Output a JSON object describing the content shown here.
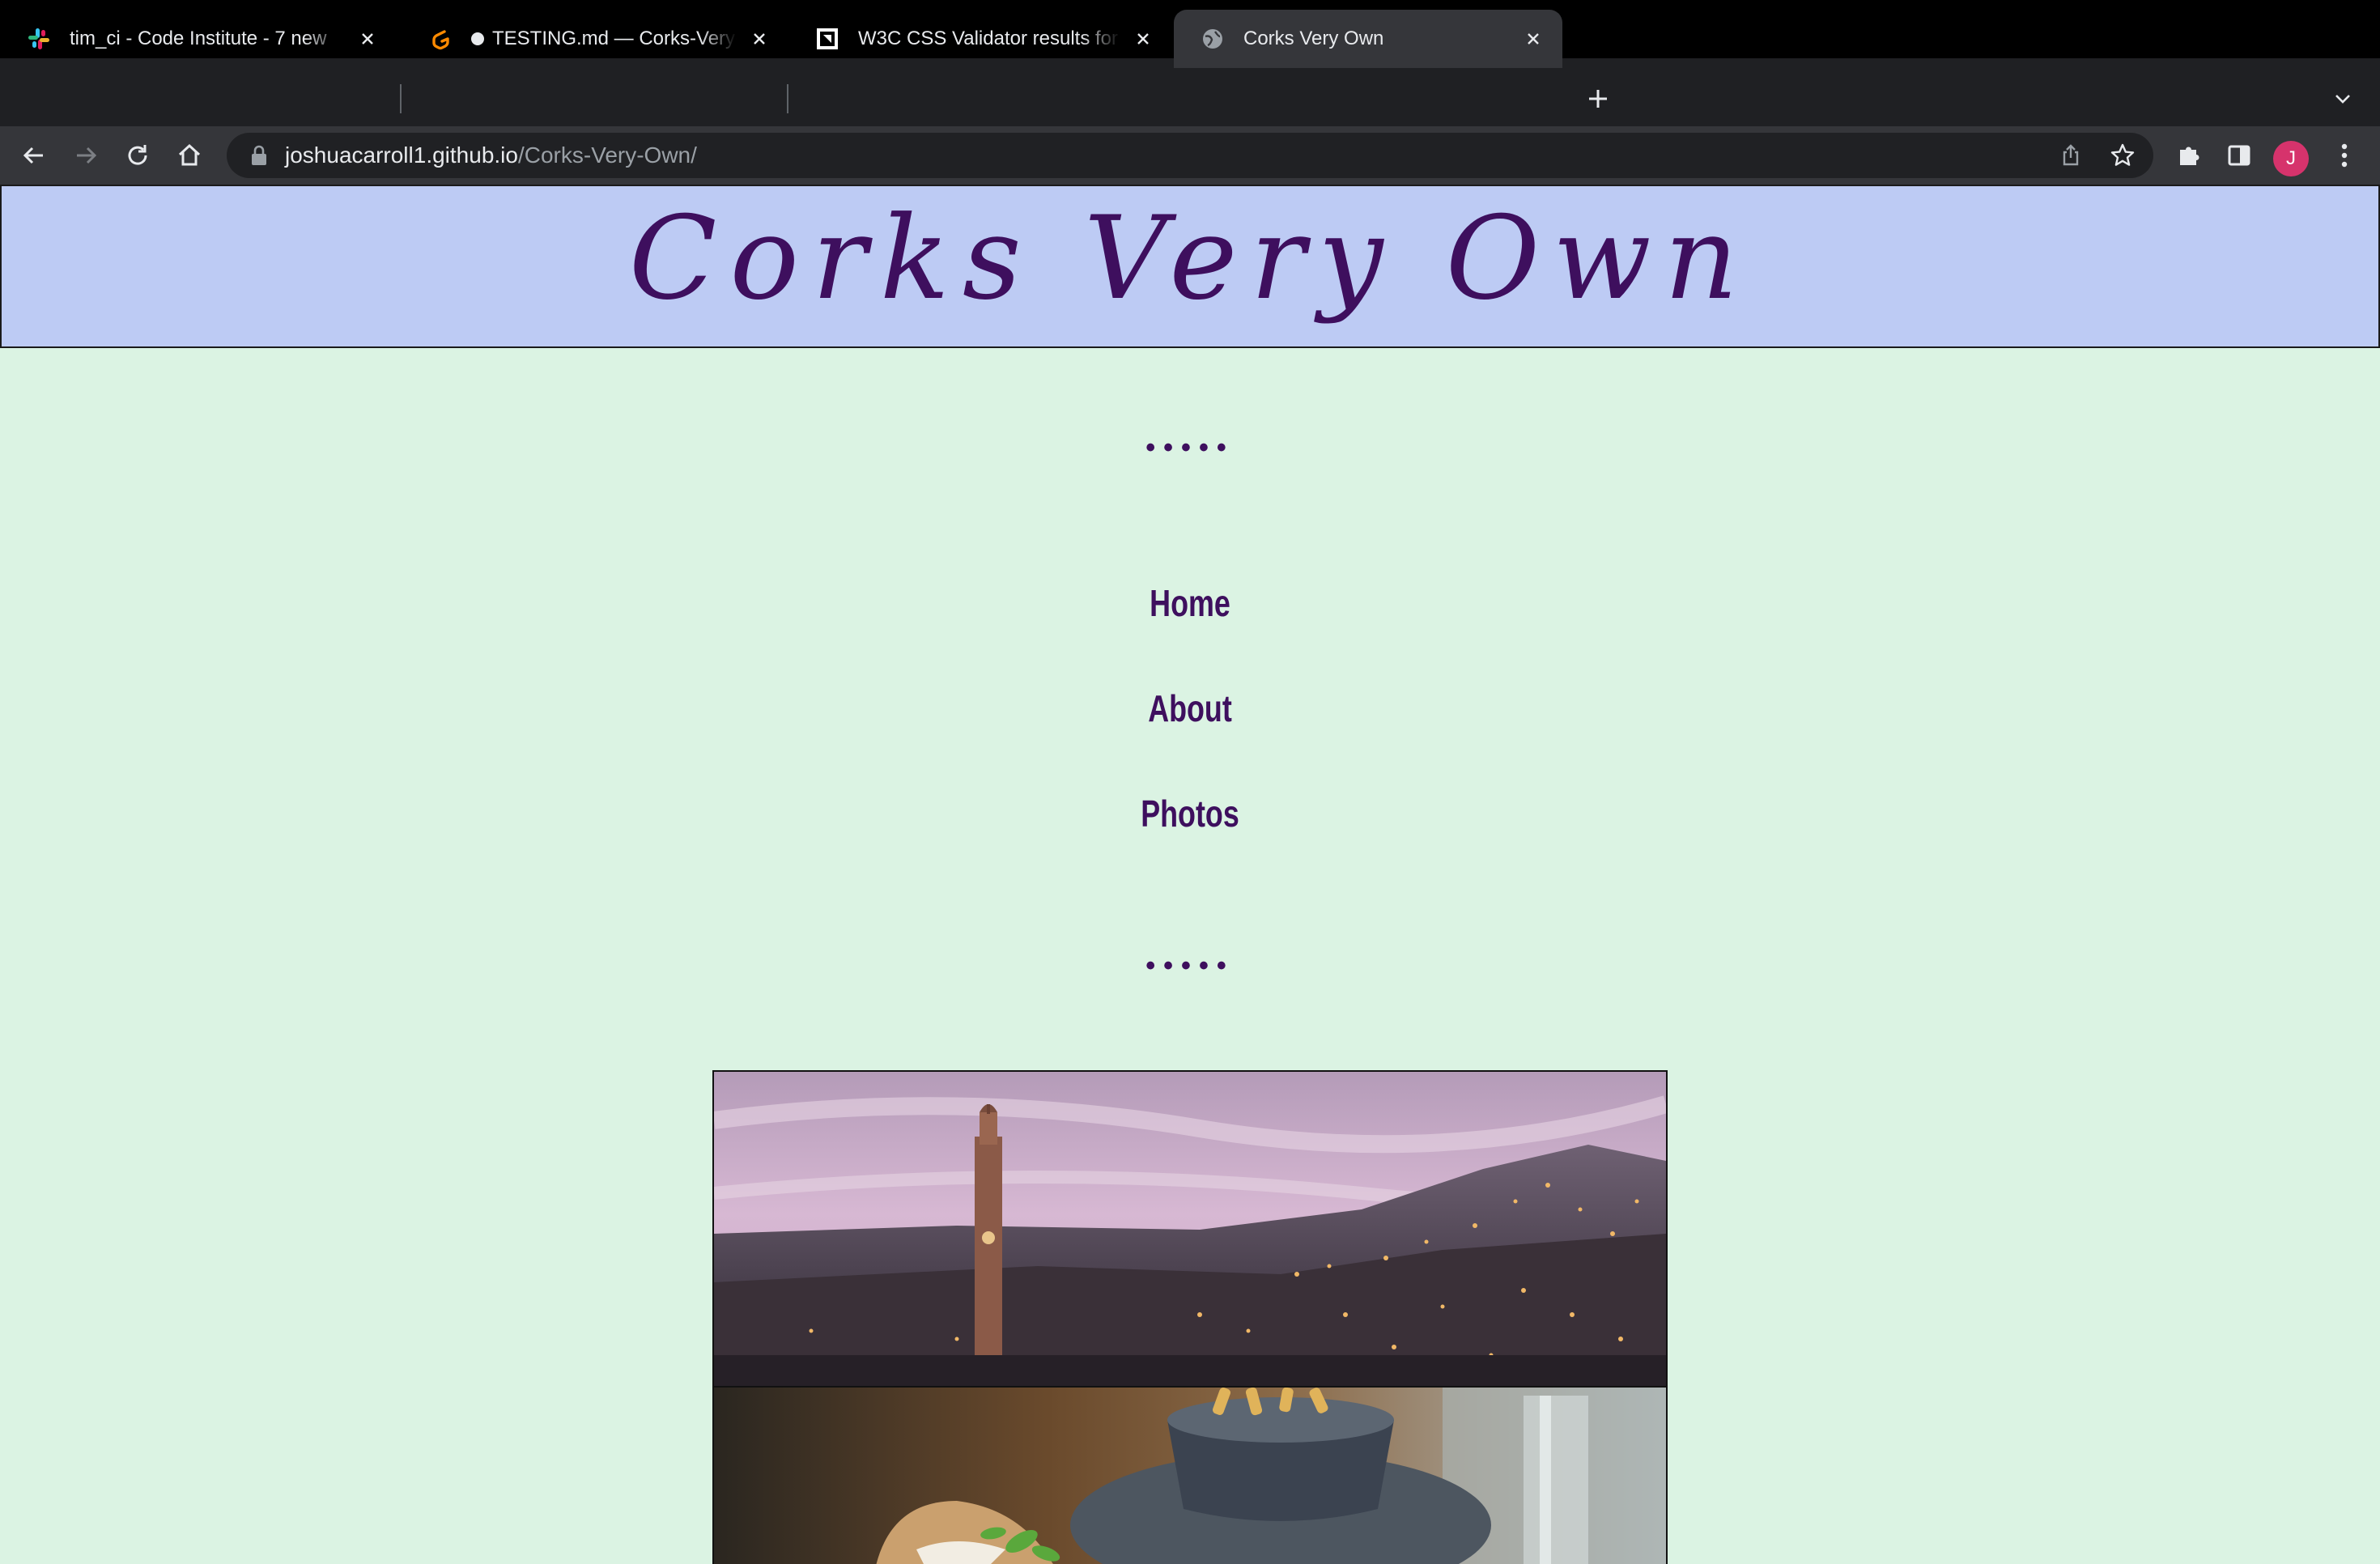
{
  "browser": {
    "tabs": [
      {
        "title": "tim_ci - Code Institute - 7 new",
        "favicon": "slack-icon",
        "active": false
      },
      {
        "title": "TESTING.md — Corks-Very-",
        "favicon": "gitpod-icon",
        "active": false,
        "unsaved": true
      },
      {
        "title": "W3C CSS Validator results for",
        "favicon": "w3c-icon",
        "active": false
      },
      {
        "title": "Corks Very Own",
        "favicon": "globe-icon",
        "active": true
      }
    ],
    "url": {
      "host": "joshuacarroll1.github.io",
      "path": "/Corks-Very-Own/"
    },
    "profile_initial": "J"
  },
  "site": {
    "title": "Corks Very Own",
    "divider": "•••••",
    "nav": [
      {
        "label": "Home"
      },
      {
        "label": "About"
      },
      {
        "label": "Photos"
      }
    ],
    "images": [
      {
        "subject": "cork-city-skyline-at-dusk"
      },
      {
        "subject": "sandwich-and-fries"
      }
    ]
  },
  "colors": {
    "page_bg": "#dbf3e3",
    "header_bg": "#bdcbf4",
    "brand_purple": "#3e0f5e"
  }
}
